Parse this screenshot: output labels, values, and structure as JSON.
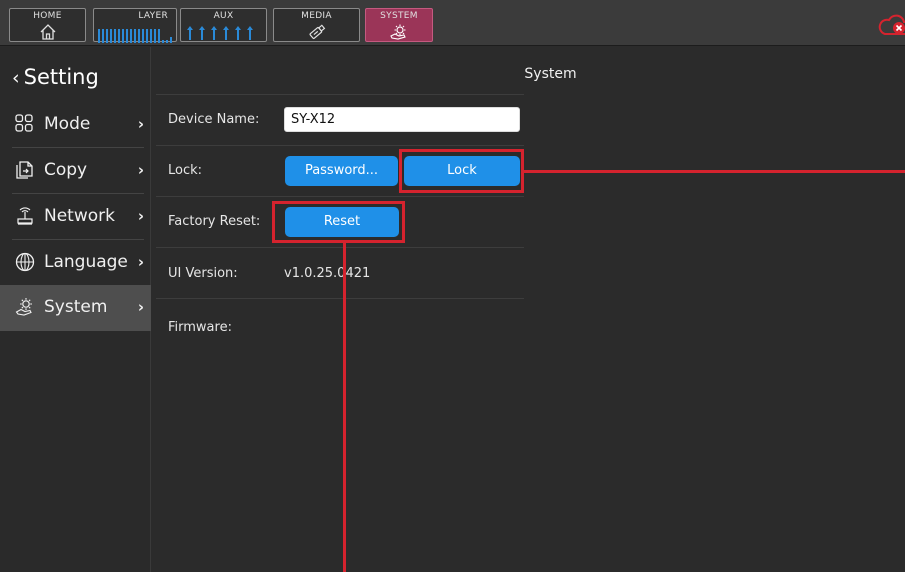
{
  "topbar": {
    "tabs": [
      {
        "label": "HOME",
        "icon": "home-icon"
      },
      {
        "label": "LAYER",
        "icon": "layer-meter-icon"
      },
      {
        "label": "AUX",
        "icon": "aux-meter-icon"
      },
      {
        "label": "MEDIA",
        "icon": "usb-drive-icon"
      },
      {
        "label": "SYSTEM",
        "icon": "gear-hand-icon"
      }
    ],
    "active_tab": "SYSTEM",
    "status_icon": "cloud-disconnected-icon",
    "colors": {
      "active_tab": "#9b3558",
      "meter": "#2a8ad8",
      "alert": "#d5232e"
    }
  },
  "sidebar": {
    "back_label": "Setting",
    "items": [
      {
        "label": "Mode",
        "icon": "grid-icon"
      },
      {
        "label": "Copy",
        "icon": "copy-icon"
      },
      {
        "label": "Network",
        "icon": "network-icon"
      },
      {
        "label": "Language",
        "icon": "globe-icon"
      },
      {
        "label": "System",
        "icon": "gear-hand-icon"
      }
    ],
    "active_item": "System"
  },
  "main": {
    "title": "System",
    "device_name_label": "Device Name:",
    "device_name_value": "SY-X12",
    "lock_label": "Lock:",
    "password_button": "Password...",
    "lock_button": "Lock",
    "factory_reset_label": "Factory Reset:",
    "reset_button": "Reset",
    "ui_version_label": "UI Version:",
    "ui_version_value": "v1.0.25.0421",
    "firmware_label": "Firmware:"
  },
  "colors": {
    "button": "#1f90e8",
    "annotation": "#d5232e"
  }
}
